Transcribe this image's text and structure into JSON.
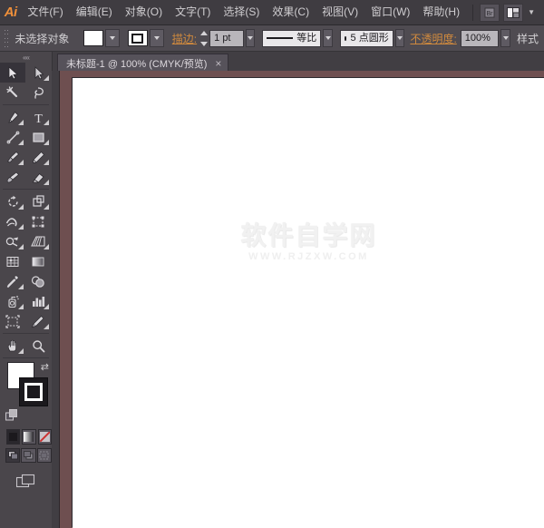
{
  "app": {
    "logo_text": "Ai",
    "title": "Adobe Illustrator"
  },
  "menubar": {
    "items": [
      {
        "label": "文件(F)",
        "name": "menu-file"
      },
      {
        "label": "编辑(E)",
        "name": "menu-edit"
      },
      {
        "label": "对象(O)",
        "name": "menu-object"
      },
      {
        "label": "文字(T)",
        "name": "menu-type"
      },
      {
        "label": "选择(S)",
        "name": "menu-select"
      },
      {
        "label": "效果(C)",
        "name": "menu-effect"
      },
      {
        "label": "视图(V)",
        "name": "menu-view"
      },
      {
        "label": "窗口(W)",
        "name": "menu-window"
      },
      {
        "label": "帮助(H)",
        "name": "menu-help"
      }
    ],
    "bridge_button_label": "Br",
    "workspace_label": ""
  },
  "controlbar": {
    "selection_status": "未选择对象",
    "fill_label": "填色",
    "stroke_color_label": "描边颜色",
    "stroke_label": "描边:",
    "stroke_weight": "1 pt",
    "profile_label": "等比",
    "brush_label": "5 点圆形",
    "opacity_label": "不透明度:",
    "opacity_value": "100%",
    "styles_label": "样式"
  },
  "tabbar": {
    "document_title": "未标题-1 @ 100% (CMYK/预览)",
    "close_label": "×"
  },
  "toolbar": {
    "collapse_label": "««",
    "tools": [
      {
        "name": "selection-tool",
        "label": "选择工具",
        "active": true,
        "flyout": false
      },
      {
        "name": "direct-selection-tool",
        "label": "直接选择工具",
        "active": false,
        "flyout": true
      },
      {
        "name": "magic-wand-tool",
        "label": "魔棒工具",
        "active": false,
        "flyout": false
      },
      {
        "name": "lasso-tool",
        "label": "套索工具",
        "active": false,
        "flyout": false
      },
      {
        "name": "pen-tool",
        "label": "钢笔工具",
        "active": false,
        "flyout": true
      },
      {
        "name": "type-tool",
        "label": "文字工具",
        "active": false,
        "flyout": true
      },
      {
        "name": "line-segment-tool",
        "label": "直线段工具",
        "active": false,
        "flyout": true
      },
      {
        "name": "rectangle-tool",
        "label": "矩形工具",
        "active": false,
        "flyout": true
      },
      {
        "name": "paintbrush-tool",
        "label": "画笔工具",
        "active": false,
        "flyout": true
      },
      {
        "name": "pencil-tool",
        "label": "铅笔工具",
        "active": false,
        "flyout": true
      },
      {
        "name": "blob-brush-tool",
        "label": "斑点画笔工具",
        "active": false,
        "flyout": false
      },
      {
        "name": "eraser-tool",
        "label": "橡皮擦工具",
        "active": false,
        "flyout": true
      },
      {
        "name": "rotate-tool",
        "label": "旋转工具",
        "active": false,
        "flyout": true
      },
      {
        "name": "scale-tool",
        "label": "比例缩放工具",
        "active": false,
        "flyout": true
      },
      {
        "name": "width-tool",
        "label": "宽度工具",
        "active": false,
        "flyout": true
      },
      {
        "name": "free-transform-tool",
        "label": "自由变换工具",
        "active": false,
        "flyout": false
      },
      {
        "name": "shape-builder-tool",
        "label": "形状生成器工具",
        "active": false,
        "flyout": true
      },
      {
        "name": "perspective-grid-tool",
        "label": "透视网格工具",
        "active": false,
        "flyout": true
      },
      {
        "name": "mesh-tool",
        "label": "网格工具",
        "active": false,
        "flyout": false
      },
      {
        "name": "gradient-tool",
        "label": "渐变工具",
        "active": false,
        "flyout": false
      },
      {
        "name": "eyedropper-tool",
        "label": "吸管工具",
        "active": false,
        "flyout": true
      },
      {
        "name": "blend-tool",
        "label": "混合工具",
        "active": false,
        "flyout": false
      },
      {
        "name": "symbol-sprayer-tool",
        "label": "符号喷枪工具",
        "active": false,
        "flyout": true
      },
      {
        "name": "column-graph-tool",
        "label": "柱形图工具",
        "active": false,
        "flyout": true
      },
      {
        "name": "artboard-tool",
        "label": "画板工具",
        "active": false,
        "flyout": false
      },
      {
        "name": "slice-tool",
        "label": "切片工具",
        "active": false,
        "flyout": true
      },
      {
        "name": "hand-tool",
        "label": "抓手工具",
        "active": false,
        "flyout": true
      },
      {
        "name": "zoom-tool",
        "label": "缩放工具",
        "active": false,
        "flyout": false
      }
    ],
    "fill_swatch_label": "填色",
    "stroke_swatch_label": "描边",
    "swap_label": "⇄",
    "default_colors_label": "默认填色和描边",
    "color_modes": [
      {
        "name": "color-mode-button",
        "label": "颜色",
        "selected": true
      },
      {
        "name": "gradient-mode-button",
        "label": "渐变",
        "selected": false
      },
      {
        "name": "none-mode-button",
        "label": "无",
        "selected": false
      }
    ],
    "draw_modes": [
      {
        "name": "draw-normal-button",
        "label": "正常绘图",
        "selected": true
      },
      {
        "name": "draw-behind-button",
        "label": "背面绘图",
        "selected": false
      },
      {
        "name": "draw-inside-button",
        "label": "内部绘图",
        "selected": false
      }
    ],
    "screen_mode_label": "更改屏幕模式"
  },
  "canvas": {
    "watermark_main": "软件自学网",
    "watermark_sub": "WWW.RJZXW.COM"
  },
  "colors": {
    "menubar_bg": "#3f3c41",
    "controlbar_bg": "#4f4b51",
    "toolbar_bg": "#4a464b",
    "canvas_bg": "#413e43",
    "artboard_bg": "#ffffff",
    "accent_orange": "#d08a3e",
    "logo_orange": "#f0903a",
    "doc_frame": "#6e4f50"
  }
}
